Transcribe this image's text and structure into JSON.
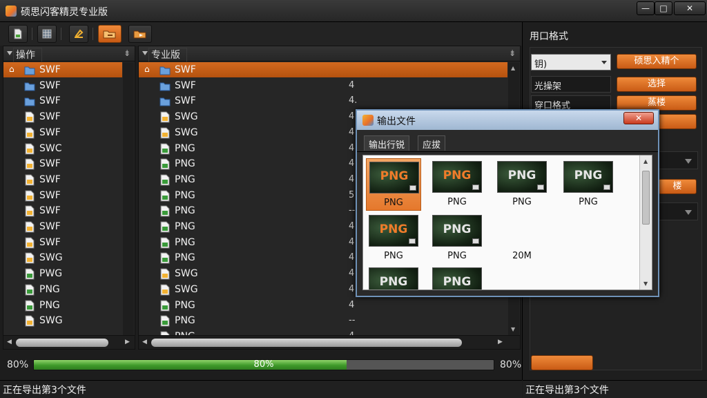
{
  "window": {
    "title": "硕思闪客精灵专业版",
    "min": "—",
    "max": "□",
    "close": "✕"
  },
  "toolbar": {
    "icons": [
      "new-file-icon",
      "grid-icon",
      "sign-icon",
      "folder-export-icon",
      "arrow-export-icon"
    ]
  },
  "left_panel": {
    "title": "操作",
    "pin": "⇟",
    "rows": [
      {
        "name": "SWF",
        "selected": true
      },
      {
        "name": "SWF"
      },
      {
        "name": "SWF"
      },
      {
        "name": "SWF"
      },
      {
        "name": "SWF"
      },
      {
        "name": "SWC"
      },
      {
        "name": "SWF"
      },
      {
        "name": "SWF"
      },
      {
        "name": "SWF"
      },
      {
        "name": "SWF"
      },
      {
        "name": "SWF"
      },
      {
        "name": "SWF"
      },
      {
        "name": "SWG"
      },
      {
        "name": "PWG"
      },
      {
        "name": "PNG"
      },
      {
        "name": "PNG"
      },
      {
        "name": "SWG"
      }
    ]
  },
  "mid_panel": {
    "title": "专业版",
    "pin": "⇟",
    "rows": [
      {
        "name": "SWF",
        "num": "",
        "selected": true
      },
      {
        "name": "SWF",
        "num": "4"
      },
      {
        "name": "SWF",
        "num": "4."
      },
      {
        "name": "SWG",
        "num": "4"
      },
      {
        "name": "SWG",
        "num": "4"
      },
      {
        "name": "PNG",
        "num": "4"
      },
      {
        "name": "PNG",
        "num": "4"
      },
      {
        "name": "PNG",
        "num": "4"
      },
      {
        "name": "PNG",
        "num": "5"
      },
      {
        "name": "PNG",
        "num": "--"
      },
      {
        "name": "PNG",
        "num": "4"
      },
      {
        "name": "PNG",
        "num": "4"
      },
      {
        "name": "PNG",
        "num": "4"
      },
      {
        "name": "SWG",
        "num": "4"
      },
      {
        "name": "SWG",
        "num": "4"
      },
      {
        "name": "PNG",
        "num": "4"
      },
      {
        "name": "PNG",
        "num": "--"
      },
      {
        "name": "PNG",
        "num": "4"
      }
    ]
  },
  "progress": {
    "left_pct": "80%",
    "right_pct": "80%",
    "bar_label": "80%",
    "value": 0.68
  },
  "status": {
    "left": "正在导出第3个文件",
    "right": "正在导出第3个文件"
  },
  "right_panel": {
    "title": "用口格式",
    "select1": "钥)",
    "btn1": "硕思入精个",
    "label1": "光操架",
    "btn2": "选择",
    "label2": "穿口格式",
    "btn3": "蒸楼",
    "btn4": "",
    "btn5": "楼"
  },
  "dialog": {
    "title": "输出文件",
    "close": "✕",
    "tabs": [
      "输出行锐",
      "应拔"
    ],
    "thumbs": [
      {
        "fmt": "PNG",
        "cap": "PNG",
        "orange": true,
        "selected": true
      },
      {
        "fmt": "PNG",
        "cap": "PNG",
        "orange": true
      },
      {
        "fmt": "PNG",
        "cap": "PNG"
      },
      {
        "fmt": "PNG",
        "cap": "PNG"
      },
      {
        "fmt": "PNG",
        "cap": "PNG",
        "orange": true
      },
      {
        "fmt": "PNG",
        "cap": "PNG"
      },
      {
        "fmt": "",
        "cap": "20M",
        "textonly": true
      },
      {
        "fmt": "PNG",
        "cap": ""
      },
      {
        "fmt": "PNG",
        "cap": ""
      }
    ]
  }
}
